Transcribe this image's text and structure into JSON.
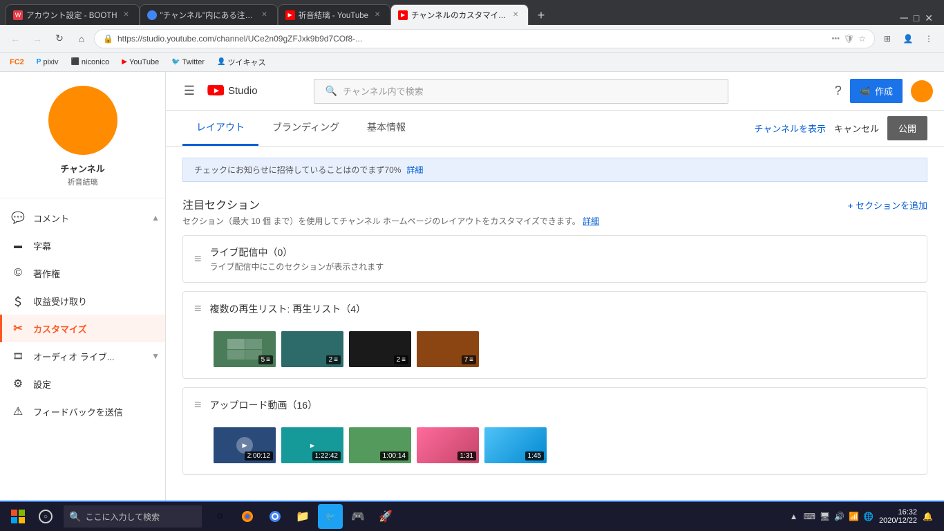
{
  "browser": {
    "tabs": [
      {
        "id": 1,
        "label": "アカウント設定 - BOOTH",
        "active": false,
        "favicon_color": "#e63946"
      },
      {
        "id": 2,
        "label": "\"チャンネル\"内にある注目チャンネル...",
        "active": false,
        "favicon_color": "#4285f4"
      },
      {
        "id": 3,
        "label": "祈音結璃 - YouTube",
        "active": false,
        "favicon_color": "#ff0000"
      },
      {
        "id": 4,
        "label": "チャンネルのカスタマイズ - YouTub...",
        "active": true,
        "favicon_color": "#ff0000"
      }
    ],
    "url": "https://studio.youtube.com/channel/UCe2n09gZFJxk9b9d7COf8-...",
    "bookmarks": [
      {
        "label": "FC2",
        "icon": "🔖"
      },
      {
        "label": "pixiv",
        "icon": "🅿"
      },
      {
        "label": "niconico",
        "icon": "🎵"
      },
      {
        "label": "YouTube",
        "icon": "▶"
      },
      {
        "label": "Twitter",
        "icon": "🐦"
      },
      {
        "label": "ツイキャス",
        "icon": "📡"
      }
    ]
  },
  "studio": {
    "logo_text": "Studio",
    "search_placeholder": "チャンネル内で検索",
    "create_button": "作成",
    "channel_name": "チャンネル",
    "channel_subtitle": "祈音結璃",
    "nav_items": [
      {
        "id": "comment",
        "label": "コメント",
        "icon": "💬"
      },
      {
        "id": "subtitle",
        "label": "字幕",
        "icon": "⬛"
      },
      {
        "id": "copyright",
        "label": "著作権",
        "icon": "©"
      },
      {
        "id": "revenue",
        "label": "収益受け取り",
        "icon": "＄"
      },
      {
        "id": "customize",
        "label": "カスタマイズ",
        "icon": "✂",
        "active": true
      },
      {
        "id": "audio",
        "label": "オーディオ ライブ...",
        "icon": "🎞"
      },
      {
        "id": "settings",
        "label": "設定",
        "icon": "⚙"
      },
      {
        "id": "feedback",
        "label": "フィードバックを送信",
        "icon": "⚠"
      }
    ],
    "tabs": [
      {
        "id": "layout",
        "label": "レイアウト",
        "active": true
      },
      {
        "id": "branding",
        "label": "ブランディング",
        "active": false
      },
      {
        "id": "basicinfo",
        "label": "基本情報",
        "active": false
      }
    ],
    "tab_actions": {
      "view_channel": "チャンネルを表示",
      "cancel": "キャンセル",
      "publish": "公開"
    },
    "notice": {
      "text": "チェックにお知らせに招待していることはのでまず70%",
      "link_text": "詳細"
    },
    "sections_header": {
      "title": "注目セクション",
      "description": "セクション（最大 10 個 まで）を使用してチャンネル ホームページのレイアウトをカスタマイズできます。",
      "detail_link": "詳細",
      "add_button": "+ セクションを追加"
    },
    "sections": [
      {
        "id": "live",
        "title": "ライブ配信中（0）",
        "description": "ライブ配信中にこのセクションが表示されます",
        "type": "live",
        "items": []
      },
      {
        "id": "playlist",
        "title": "複数の再生リスト: 再生リスト（4）",
        "description": "",
        "type": "playlist",
        "items": [
          {
            "count": "5",
            "color": "thumb-green"
          },
          {
            "count": "2",
            "color": "thumb-teal"
          },
          {
            "count": "2",
            "color": "thumb-dark"
          },
          {
            "count": "7",
            "color": "thumb-purple"
          }
        ]
      },
      {
        "id": "uploads",
        "title": "アップロード動画（16）",
        "description": "",
        "type": "videos",
        "items": [
          {
            "time": "2:00:12",
            "color": "thumb-blue"
          },
          {
            "time": "1:22:42",
            "color": "thumb-teal"
          },
          {
            "time": "1:00:14",
            "color": "thumb-green"
          },
          {
            "time": "1:31",
            "color": "thumb-colorful"
          },
          {
            "time": "1:45",
            "color": "thumb-warm"
          }
        ]
      }
    ]
  },
  "taskbar": {
    "search_placeholder": "ここに入力して検索",
    "time": "16:32",
    "date": "2020/12/22"
  }
}
